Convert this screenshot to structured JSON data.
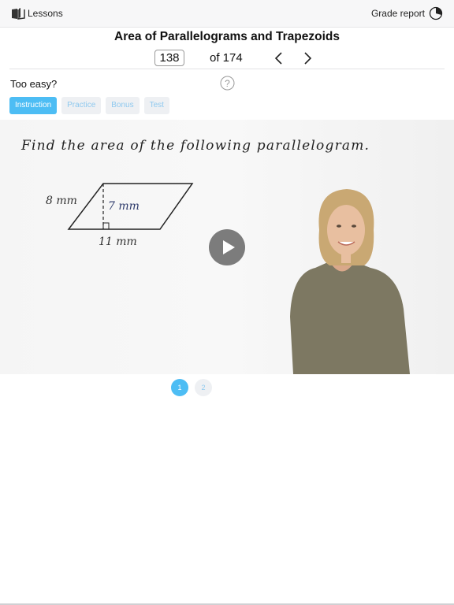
{
  "topbar": {
    "lessons_label": "Lessons",
    "lessons_icon": "book-icon",
    "grade_report_label": "Grade report",
    "grade_report_icon": "pie-chart-icon"
  },
  "lesson": {
    "title": "Area of Parallelograms and Trapezoids",
    "current_page": "138",
    "of_label": "of 174",
    "prev_icon": "chevron-left-icon",
    "next_icon": "chevron-right-icon"
  },
  "controls": {
    "too_easy_label": "Too easy?",
    "help_icon": "question-circle-icon"
  },
  "tabs": [
    {
      "label": "Instruction",
      "active": true
    },
    {
      "label": "Practice",
      "active": false
    },
    {
      "label": "Bonus",
      "active": false
    },
    {
      "label": "Test",
      "active": false
    }
  ],
  "video": {
    "board_heading": "Find the area of the following parallelogram.",
    "side_label": "8 mm",
    "height_label": "7 mm",
    "base_label": "11 mm",
    "play_icon": "play-icon"
  },
  "pagination": [
    {
      "label": "1",
      "active": true
    },
    {
      "label": "2",
      "active": false
    }
  ],
  "colors": {
    "accent": "#4dbdf4",
    "tab_inactive_bg": "#eef0f3",
    "tab_inactive_text": "#8fc9ef",
    "topbar_bg": "#f7f7f8"
  }
}
